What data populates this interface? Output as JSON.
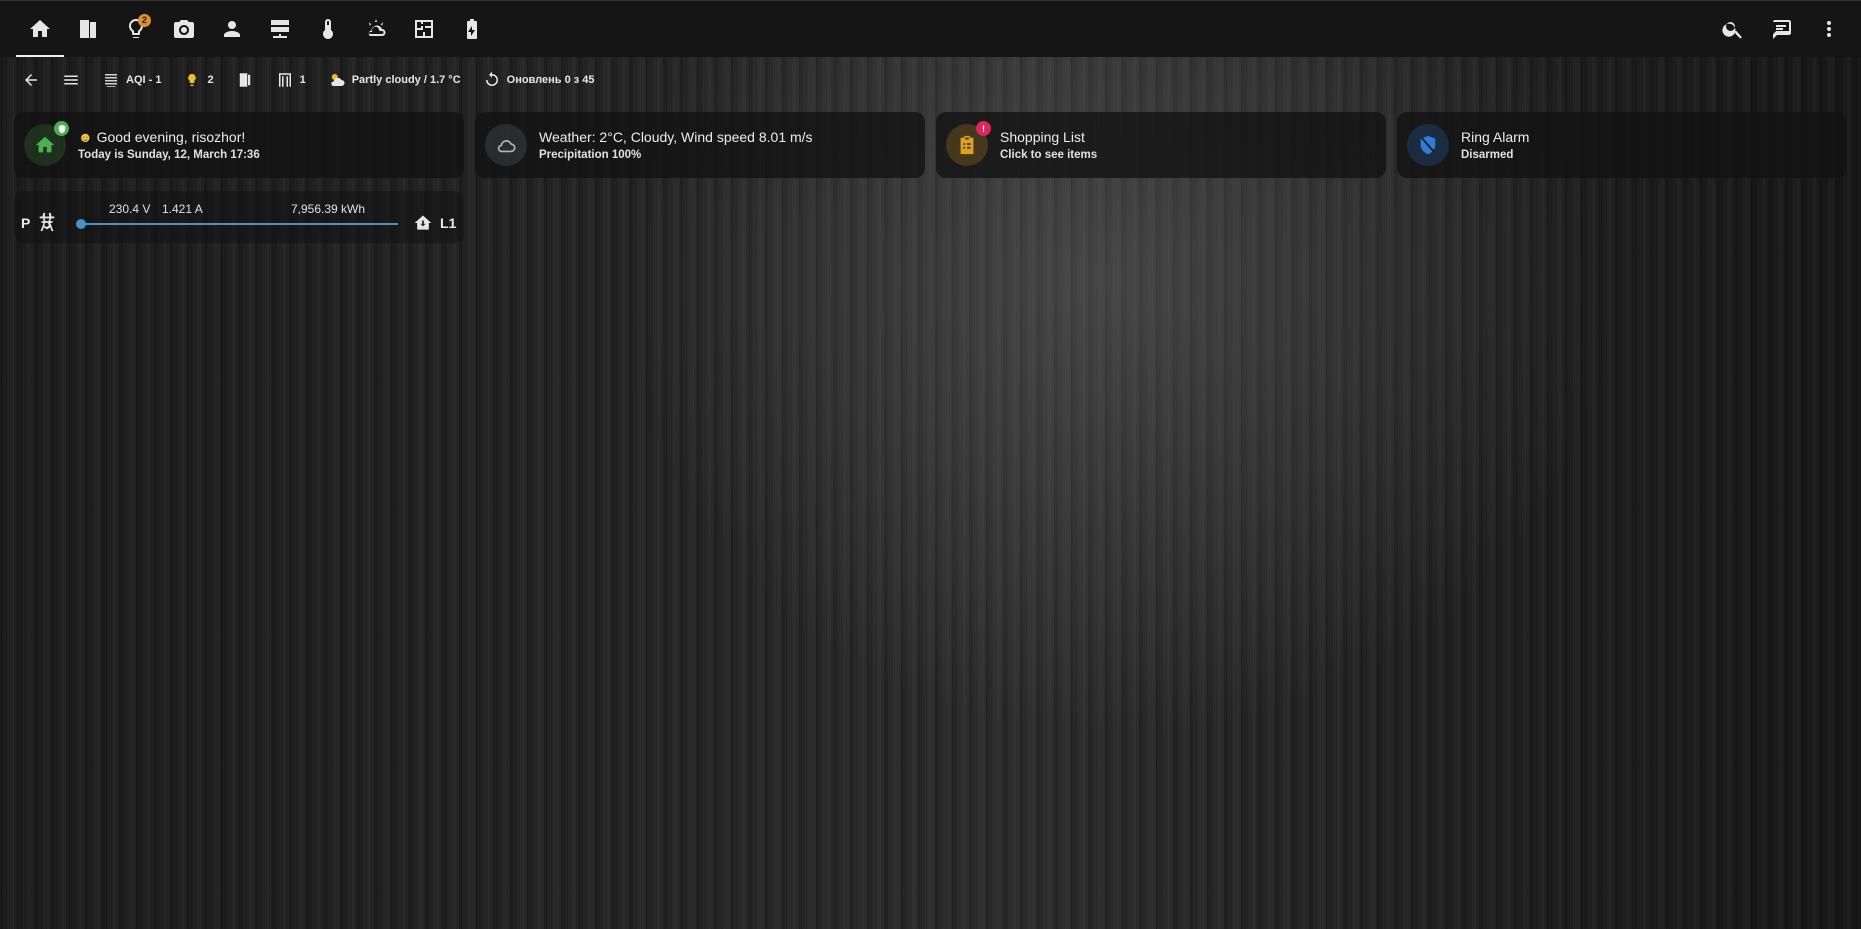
{
  "topbar": {
    "tabs": [
      {
        "icon": "home-icon",
        "active": true
      },
      {
        "icon": "room-icon"
      },
      {
        "icon": "lightbulb-icon",
        "badge": "2"
      },
      {
        "icon": "camera-icon"
      },
      {
        "icon": "person-icon"
      },
      {
        "icon": "server-icon"
      },
      {
        "icon": "thermometer-icon"
      },
      {
        "icon": "weather-icon"
      },
      {
        "icon": "floorplan-icon"
      },
      {
        "icon": "battery-charging-icon"
      }
    ],
    "actions": [
      "search-icon",
      "message-icon",
      "more-vertical-icon"
    ]
  },
  "chips": {
    "aqi": "AQI - 1",
    "lights": "2",
    "doors": "1",
    "weather": "Partly cloudy / 1.7 °C",
    "updated": "Оновлень 0 з 45"
  },
  "cards": {
    "greeting": {
      "title": "Good evening, risozhor!",
      "subtitle": "Today is Sunday, 12, March 17:36"
    },
    "weather": {
      "title": "Weather: 2°C, Cloudy, Wind speed 8.01 m/s",
      "subtitle": "Precipitation 100%"
    },
    "shopping": {
      "title": "Shopping List",
      "subtitle": "Click to see items",
      "badge": "!"
    },
    "alarm": {
      "title": "Ring Alarm",
      "subtitle": "Disarmed"
    }
  },
  "power": {
    "left_label": "P",
    "right_label": "L1",
    "voltage": "230.4 V",
    "current": "1.421 A",
    "energy": "7,956.39 kWh"
  },
  "colors": {
    "greeting_icon": "#4caf50",
    "shopping_icon": "#e0a020",
    "alarm_icon": "#2f7dd6",
    "weather_icon": "#b0b8c0",
    "badge_red": "#e0245e",
    "line_blue": "#4a90c8"
  }
}
